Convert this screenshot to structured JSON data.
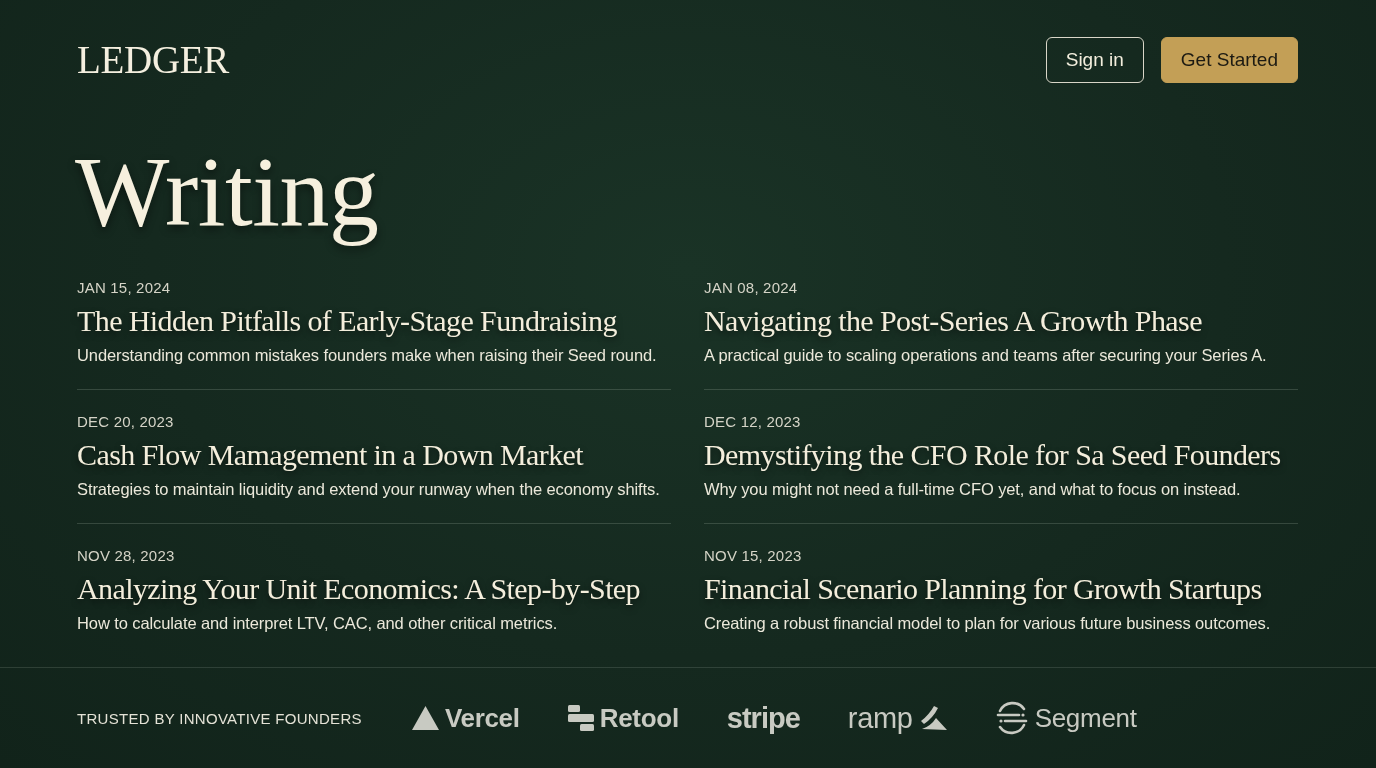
{
  "header": {
    "logo": "LEDGER",
    "buttons": [
      {
        "label": "Sign in",
        "kind": "outline"
      },
      {
        "label": "Get Started",
        "kind": "filled"
      }
    ]
  },
  "heading": "Writing",
  "articles": [
    {
      "date": "JAN 15, 2024",
      "title": "The Hidden Pitfalls of Early-Stage Fundraising",
      "summary": "Understanding common mistakes founders make when raising their Seed round."
    },
    {
      "date": "JAN 08, 2024",
      "title": "Navigating the Post-Series A Growth Phase",
      "summary": "A practical guide to scaling operations and teams after securing your Series A."
    },
    {
      "date": "DEC 20, 2023",
      "title": "Cash Flow Mamagement in a Down Market",
      "summary": "Strategies to maintain liquidity and extend your runway when the economy shifts."
    },
    {
      "date": "DEC 12, 2023",
      "title": "Demystifying the CFO Role for Sa Seed Founders",
      "summary": "Why you might not need a full-time CFO yet, and what to focus on instead."
    },
    {
      "date": "NOV 28, 2023",
      "title": "Analyzing Your Unit Economics: A Step-by-Step",
      "summary": "How to calculate and interpret LTV, CAC, and other critical metrics."
    },
    {
      "date": "NOV 15, 2023",
      "title": "Financial Scenario Planning for Growth Startups",
      "summary": "Creating a robust financial model to plan for various future business outcomes."
    }
  ],
  "footer": {
    "tagline": "TRUSTED BY INNOVATIVE FOUNDERS",
    "logos": [
      {
        "name": "Vercel",
        "kind": "triangle"
      },
      {
        "name": "Retool",
        "kind": "bars"
      },
      {
        "name": "stripe",
        "kind": "wordmark"
      },
      {
        "name": "ramp",
        "kind": "swoosh"
      },
      {
        "name": "Segment",
        "kind": "ring"
      }
    ]
  }
}
